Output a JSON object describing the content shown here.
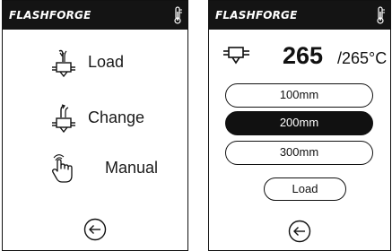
{
  "left_screen": {
    "brand": "FLASHFORGE",
    "menu": [
      {
        "label": "Load",
        "icon": "extruder-load-icon"
      },
      {
        "label": "Change",
        "icon": "extruder-change-icon"
      },
      {
        "label": "Manual",
        "icon": "hand-tap-icon"
      }
    ]
  },
  "right_screen": {
    "brand": "FLASHFORGE",
    "current_temp": "265",
    "target_temp": "/265°C",
    "lengths": [
      {
        "label": "100mm",
        "selected": false
      },
      {
        "label": "200mm",
        "selected": true
      },
      {
        "label": "300mm",
        "selected": false
      }
    ],
    "load_label": "Load"
  },
  "colors": {
    "header": "#141414",
    "accent": "#111111",
    "background": "#ffffff"
  }
}
